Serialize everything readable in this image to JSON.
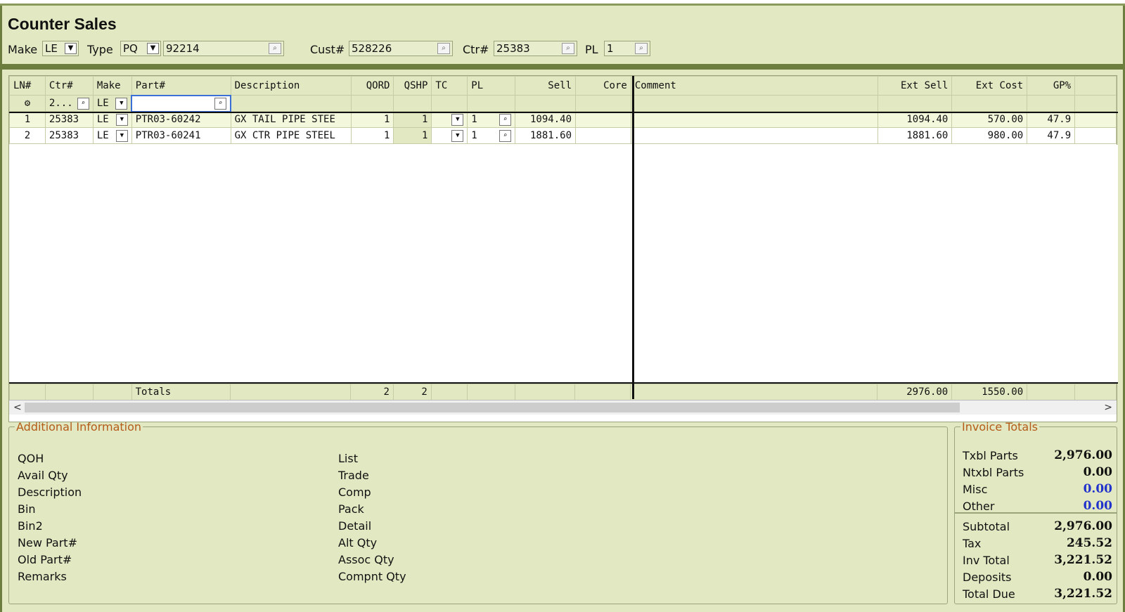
{
  "header": {
    "title": "Counter Sales",
    "make_label": "Make",
    "make_value": "LE",
    "type_label": "Type",
    "type_value": "PQ",
    "doc_number": "92214",
    "cust_label": "Cust#",
    "cust_value": "528226",
    "ctr_label": "Ctr#",
    "ctr_value": "25383",
    "pl_label": "PL",
    "pl_value": "1"
  },
  "grid": {
    "columns": [
      "LN#",
      "Ctr#",
      "Make",
      "Part#",
      "Description",
      "QORD",
      "QSHP",
      "TC",
      "PL",
      "Sell",
      "Core",
      "Comment",
      "Ext Sell",
      "Ext Cost",
      "GP%"
    ],
    "filter": {
      "ctr": "2...",
      "make": "LE",
      "part": ""
    },
    "rows": [
      {
        "ln": "1",
        "ctr": "25383",
        "make": "LE",
        "part": "PTR03-60242",
        "description": "GX TAIL PIPE STEE",
        "qord": "1",
        "qshp": "1",
        "tc": "",
        "pl": "1",
        "sell": "1094.40",
        "core": "",
        "comment": "",
        "ext_sell": "1094.40",
        "ext_cost": "570.00",
        "gp": "47.9"
      },
      {
        "ln": "2",
        "ctr": "25383",
        "make": "LE",
        "part": "PTR03-60241",
        "description": "GX CTR PIPE STEEL",
        "qord": "1",
        "qshp": "1",
        "tc": "",
        "pl": "1",
        "sell": "1881.60",
        "core": "",
        "comment": "",
        "ext_sell": "1881.60",
        "ext_cost": "980.00",
        "gp": "47.9"
      }
    ],
    "totals": {
      "label": "Totals",
      "qord": "2",
      "qshp": "2",
      "ext_sell": "2976.00",
      "ext_cost": "1550.00"
    }
  },
  "additional_info": {
    "legend": "Additional Information",
    "left_labels": [
      "QOH",
      "Avail Qty",
      "Description",
      "Bin",
      "Bin2",
      "New Part#",
      "Old Part#",
      "Remarks"
    ],
    "right_labels": [
      "List",
      "Trade",
      "Comp",
      "Pack",
      "Detail",
      "Alt Qty",
      "Assoc Qty",
      "Compnt Qty"
    ]
  },
  "invoice_totals": {
    "legend": "Invoice Totals",
    "items": [
      {
        "label": "Txbl Parts",
        "value": "2,976.00"
      },
      {
        "label": "Ntxbl Parts",
        "value": "0.00"
      },
      {
        "label": "Misc",
        "value": "0.00"
      },
      {
        "label": "Other",
        "value": "0.00"
      },
      {
        "label": "Subtotal",
        "value": "2,976.00"
      },
      {
        "label": "Tax",
        "value": "245.52"
      },
      {
        "label": "Inv Total",
        "value": "3,221.52"
      },
      {
        "label": "Deposits",
        "value": "0.00"
      },
      {
        "label": "Total Due",
        "value": "3,221.52"
      }
    ],
    "link_color": "#2233cc"
  },
  "icons": {
    "dropdown": "chevron-down-icon",
    "search": "magnifier-icon",
    "row_action": "gear-icon",
    "scroll_left": "arrow-left-icon",
    "scroll_right": "arrow-right-icon"
  }
}
